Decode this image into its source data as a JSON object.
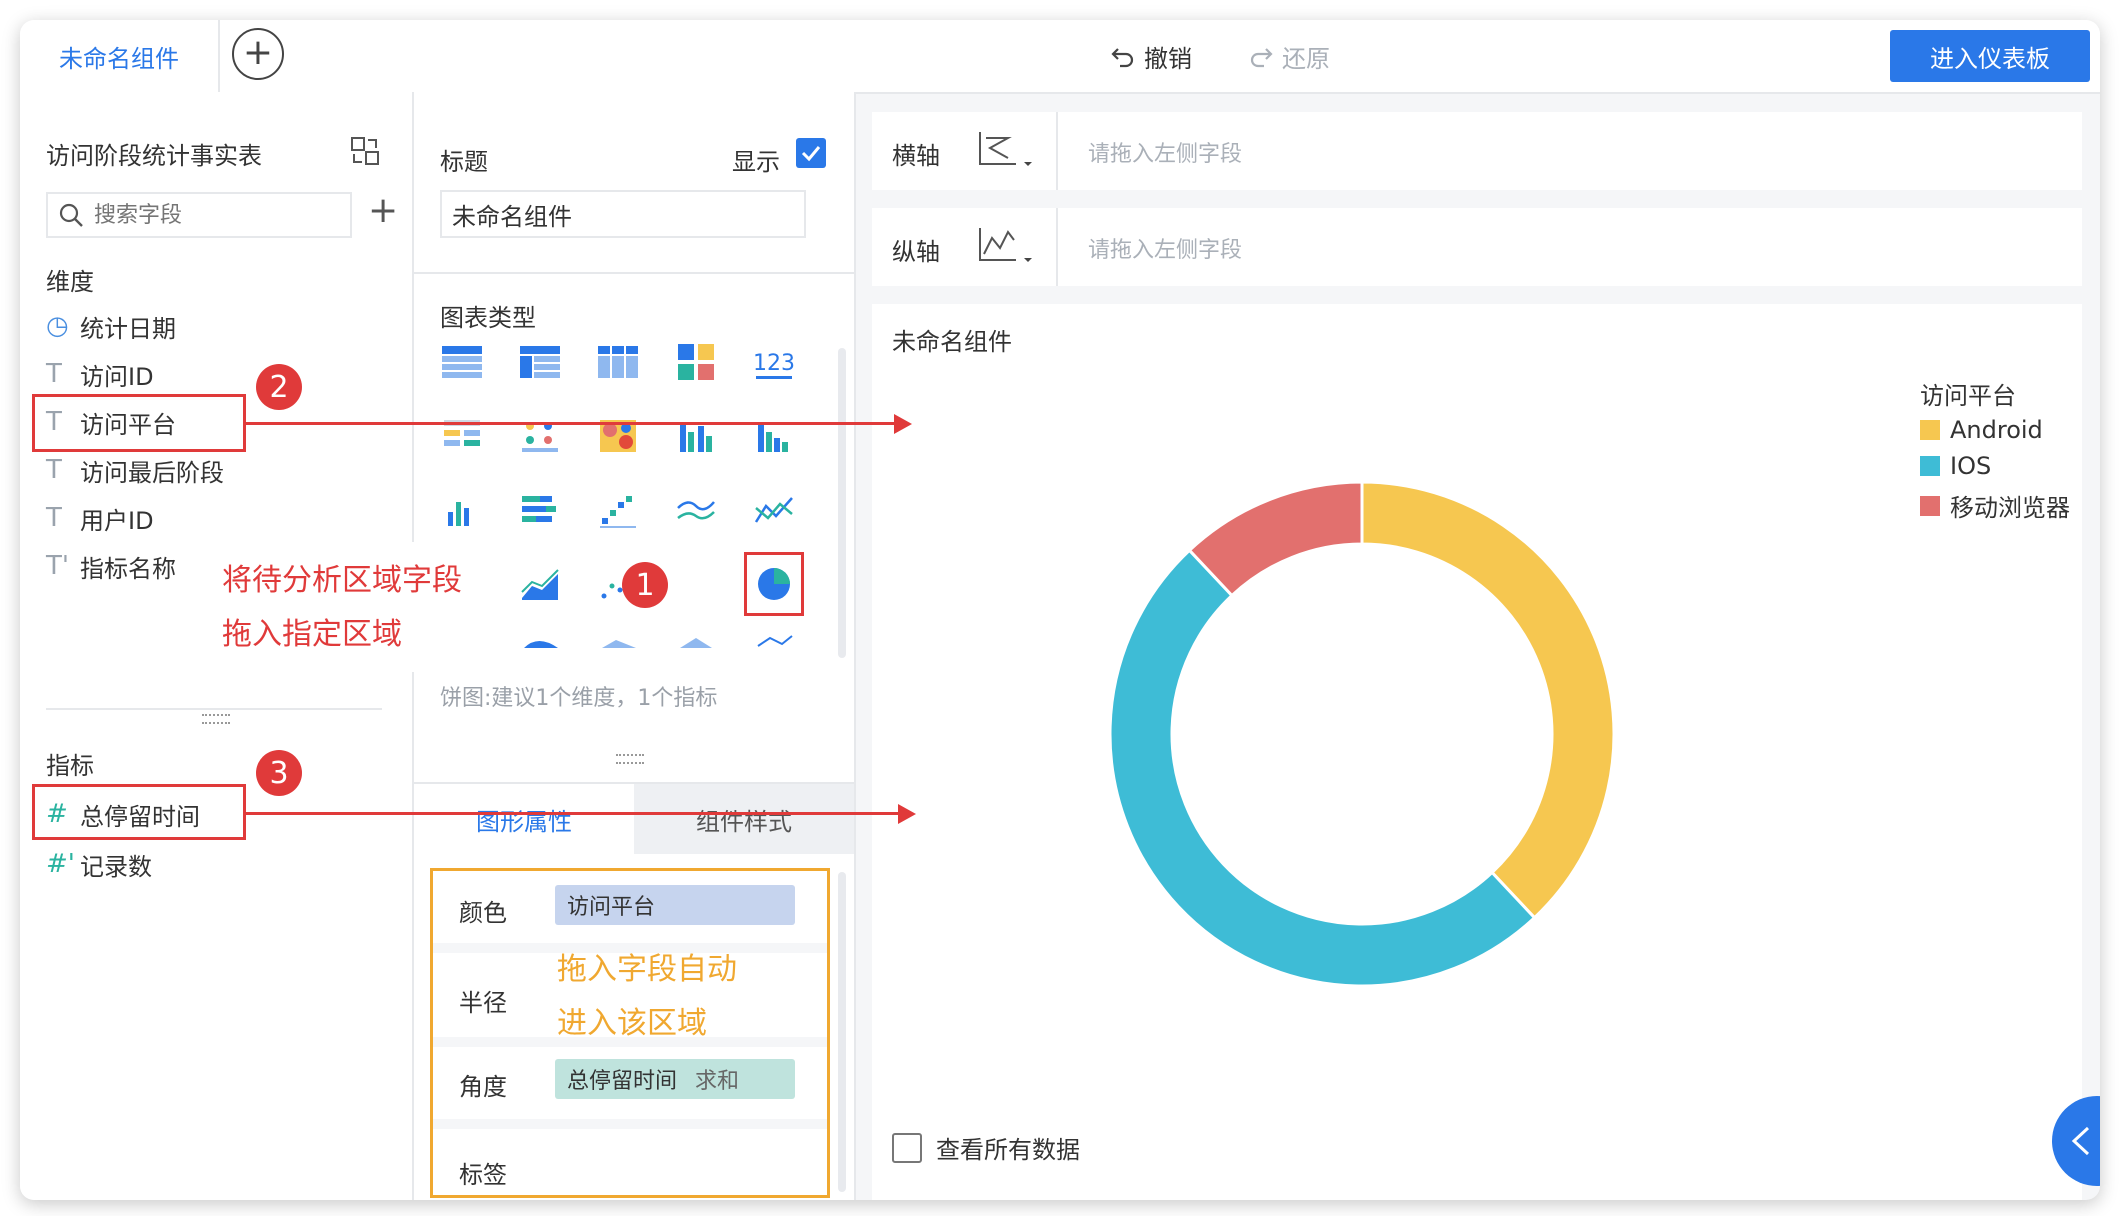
{
  "topbar": {
    "tab_name": "未命名组件",
    "undo_label": "撤销",
    "redo_label": "还原",
    "enter_dashboard_label": "进入仪表板"
  },
  "left_panel": {
    "table_name": "访问阶段统计事实表",
    "search_placeholder": "搜索字段",
    "dimensions_label": "维度",
    "dimensions": [
      {
        "label": "统计日期",
        "icon": "clock-icon"
      },
      {
        "label": "访问ID",
        "icon": "text-type-icon"
      },
      {
        "label": "访问平台",
        "icon": "text-type-icon"
      },
      {
        "label": "访问最后阶段",
        "icon": "text-type-icon"
      },
      {
        "label": "用户ID",
        "icon": "text-type-icon"
      },
      {
        "label": "指标名称",
        "icon": "text-derived-icon"
      }
    ],
    "measures_label": "指标",
    "measures": [
      {
        "label": "总停留时间",
        "icon": "hash-icon"
      },
      {
        "label": "记录数",
        "icon": "hash-derived-icon"
      }
    ]
  },
  "middle_panel": {
    "title_label": "标题",
    "show_label": "显示",
    "title_value": "未命名组件",
    "chart_type_label": "图表类型",
    "chart_hint": "饼图:建议1个维度，1个指标",
    "tabs": [
      "图形属性",
      "组件样式"
    ],
    "props": {
      "color_label": "颜色",
      "color_field": "访问平台",
      "radius_label": "半径",
      "angle_label": "角度",
      "angle_field": "总停留时间",
      "angle_agg": "求和",
      "tag_label": "标签"
    }
  },
  "axes": {
    "x_label": "横轴",
    "y_label": "纵轴",
    "placeholder": "请拖入左侧字段"
  },
  "canvas": {
    "title": "未命名组件",
    "view_all_label": "查看所有数据"
  },
  "chart_data": {
    "type": "pie",
    "donut": true,
    "legend_title": "访问平台",
    "legend_position": "top-right",
    "slices": [
      {
        "name": "Android",
        "value": 38,
        "color": "#f6c750"
      },
      {
        "name": "IOS",
        "value": 50,
        "color": "#3ebcd6"
      },
      {
        "name": "移动浏览器",
        "value": 12,
        "color": "#e2706e"
      }
    ]
  },
  "annotations": {
    "badge_1": "1",
    "badge_2": "2",
    "badge_3": "3",
    "note_red_line1": "将待分析区域字段",
    "note_red_line2": "拖入指定区域",
    "note_orange_line1": "拖入字段自动",
    "note_orange_line2": "进入该区域"
  },
  "colors": {
    "accent": "#2a78e8",
    "annotation_red": "#e03a3a",
    "annotation_orange": "#f0a830"
  }
}
